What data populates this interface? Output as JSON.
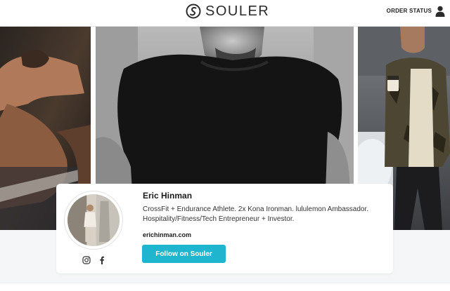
{
  "header": {
    "brand": "SOULER",
    "order_status": "ORDER STATUS",
    "icons": {
      "logo": "souler-logo-icon",
      "user": "user-icon"
    }
  },
  "gallery": {
    "images": [
      "athlete-stretching-photo",
      "athlete-black-tshirt-photo",
      "man-camo-jacket-coffee-photo"
    ]
  },
  "profile": {
    "name": "Eric Hinman",
    "bio_line1": "CrossFit + Endurance Athlete. 2x Kona Ironman. lululemon Ambassador.",
    "bio_line2": "Hospitality/Fitness/Tech Entrepreneur + Investor.",
    "website": "erichinman.com",
    "follow_label": "Follow on Souler",
    "social_icons": [
      "instagram-icon",
      "facebook-icon"
    ]
  },
  "colors": {
    "accent": "#1fb5cf",
    "background": "#f4f6f7"
  }
}
